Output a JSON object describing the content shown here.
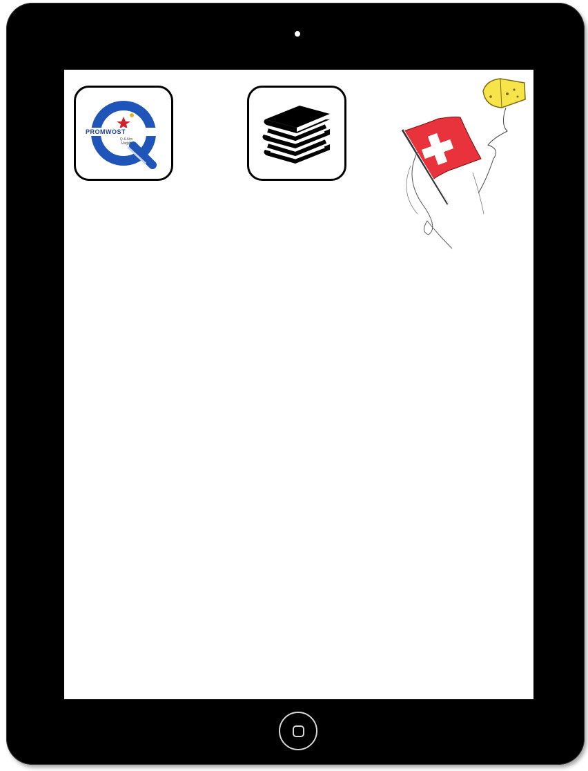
{
  "device": {
    "type": "tablet",
    "bezel_color": "#000000",
    "screen_color": "#ffffff"
  },
  "apps": [
    {
      "id": "q-app",
      "icon": "q-logo-icon",
      "brand_text": "PROMWOST",
      "subtitle_line1": "Q & Aim",
      "subtitle_line2": "Margin"
    },
    {
      "id": "books-app",
      "icon": "books-stack-icon"
    }
  ],
  "decoration": {
    "items": [
      "swiss-flag-icon",
      "cheese-icon"
    ],
    "colors": {
      "flag_red": "#e8323c",
      "cheese_yellow": "#f7e34a"
    }
  },
  "colors": {
    "q_blue": "#1f55b8",
    "q_red": "#d2232a"
  }
}
